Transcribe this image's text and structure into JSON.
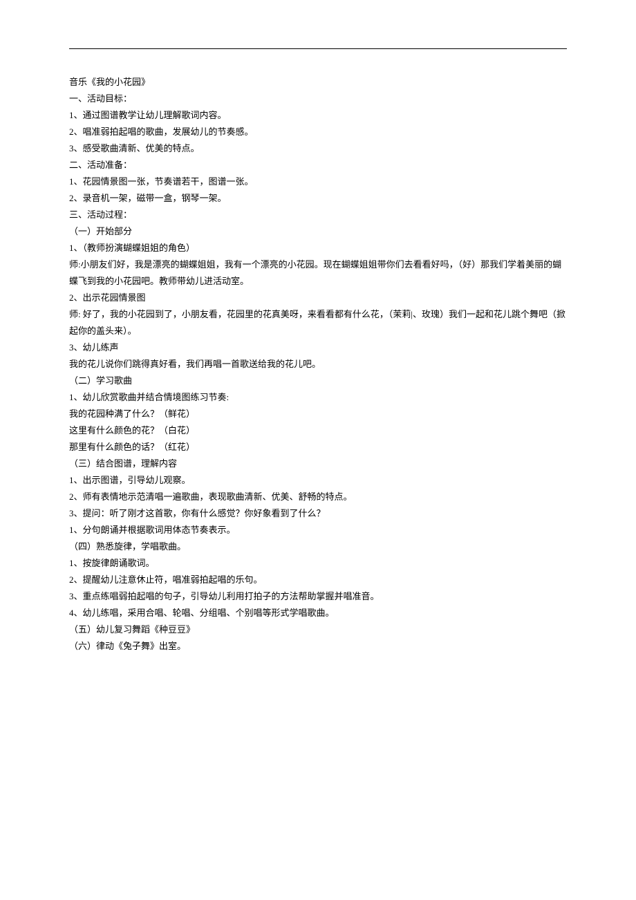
{
  "lines": [
    "音乐《我的小花园》",
    "一、活动目标：",
    "1、通过图谱教学让幼儿理解歌词内容。",
    "2、唱准弱拍起唱的歌曲，发展幼儿的节奏感。",
    "3、感受歌曲清新、优美的特点。",
    "二、活动准备：",
    "1、花园情景图一张，节奏谱若干，图谱一张。",
    "2、录音机一架，磁带一盒，钢琴一架。",
    "三、活动过程：",
    "（一）开始部分",
    "1、（教师扮演蝴蝶姐姐的角色）",
    "师:小朋友们好，我是漂亮的蝴蝶姐姐，我有一个漂亮的小花园。现在蝴蝶姐姐带你们去看看好吗，（好）那我们学着美丽的蝴蝶飞到我的小花园吧。教师带幼儿进活动室。",
    "2、出示花园情景图",
    "师: 好了，我的小花园到了，小朋友看，花园里的花真美呀，来看看都有什么花，（茉莉|、玫瑰）我们一起和花儿跳个舞吧（掀起你的盖头来）。",
    "3、幼儿练声",
    "我的花儿说你们跳得真好看，我们再唱一首歌送给我的花儿吧。",
    "（二）学习歌曲",
    "1、幼儿欣赏歌曲并结合情境图练习节奏:",
    "我的花园种满了什么？（鲜花）",
    "这里有什么颜色的花？（白花）",
    "那里有什么颜色的话？（红花）",
    "（三）结合图谱，理解内容",
    "1、出示图谱，引导幼儿观察。",
    "2、师有表情地示范清唱一遍歌曲，表现歌曲清新、优美、舒畅的特点。",
    "3、提问：听了刚才这首歌，你有什么感觉？你好象看到了什么？",
    "1、分句朗诵并根据歌词用体态节奏表示。",
    "（四）熟悉旋律，学唱歌曲。",
    "1、按旋律朗诵歌词。",
    "2、提醒幼儿注意休止符，唱准弱拍起唱的乐句。",
    "3、重点练唱弱拍起唱的句子，引导幼儿利用打拍子的方法帮助掌握并唱准音。",
    "4、幼儿练唱，采用合唱、轮唱、分组唱、个别唱等形式学唱歌曲。",
    "（五）幼儿复习舞蹈《种豆豆》",
    "（六）律动《兔子舞》出室。"
  ]
}
